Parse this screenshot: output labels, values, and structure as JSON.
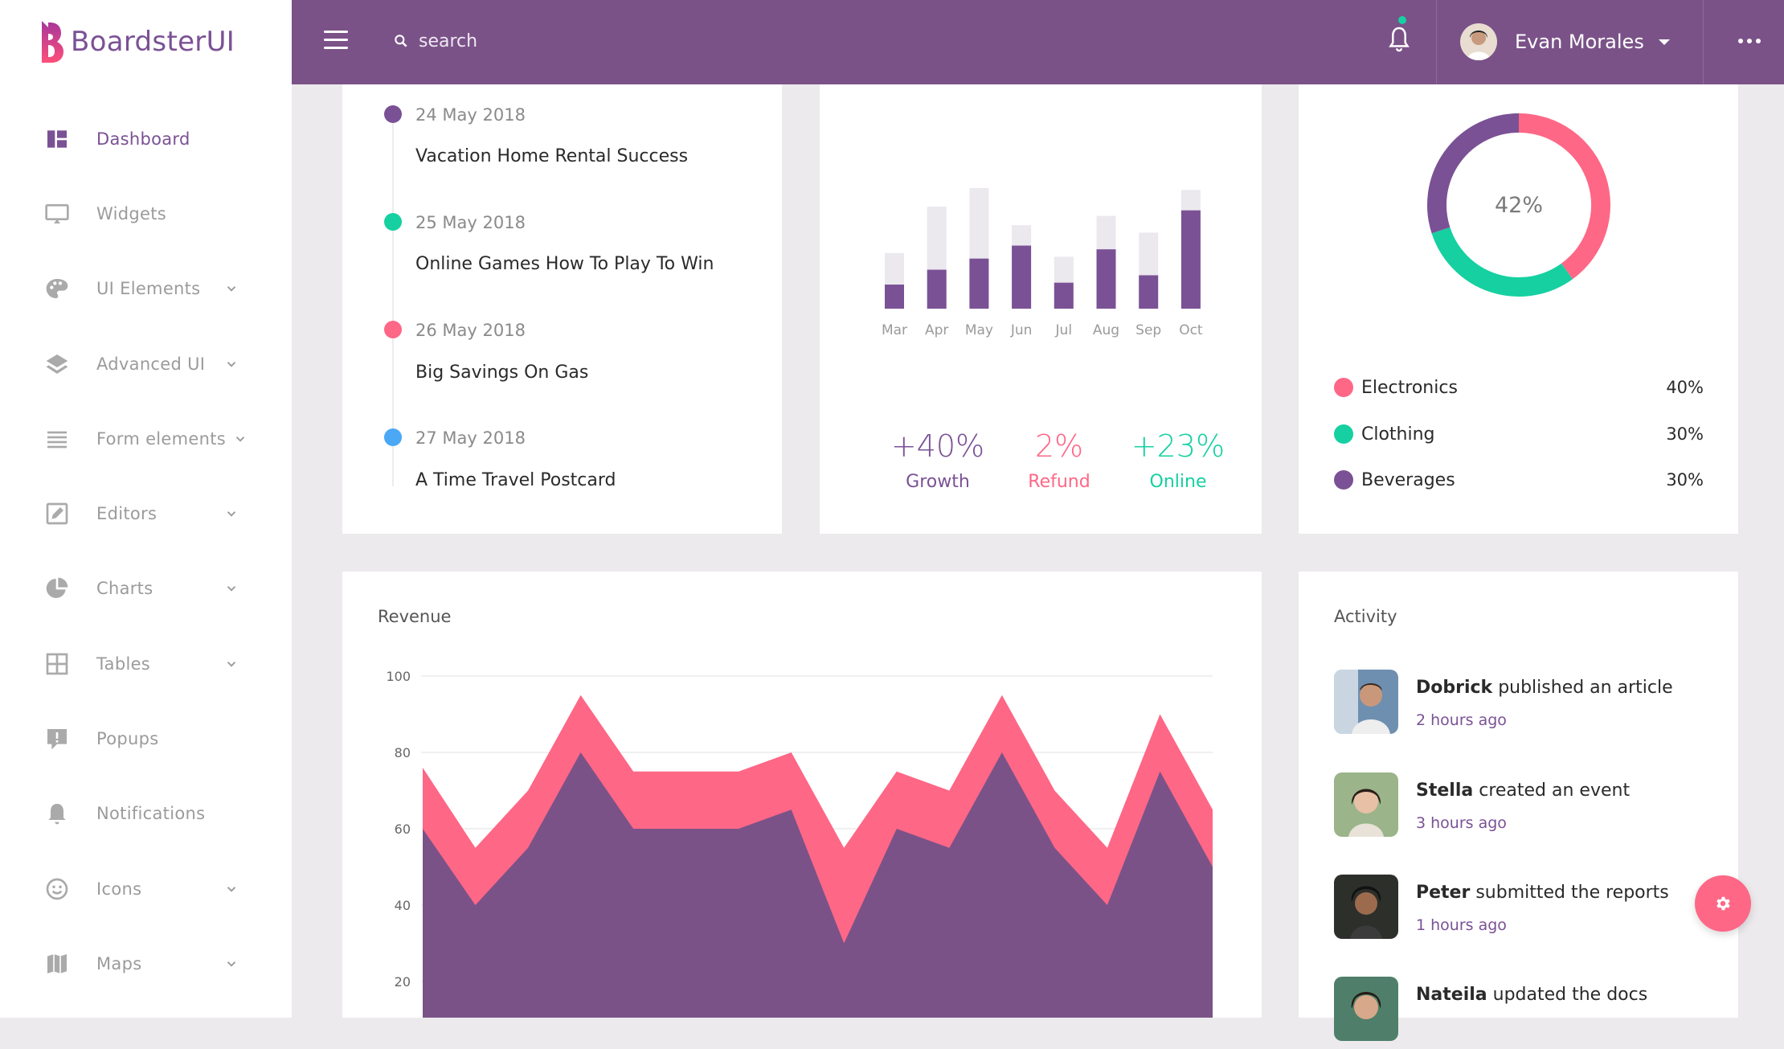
{
  "brand": {
    "name": "BoardsterUI"
  },
  "sidebar": {
    "items": [
      {
        "label": "Dashboard",
        "icon": "dashboard-icon",
        "active": true,
        "chevron": false
      },
      {
        "label": "Widgets",
        "icon": "monitor-icon",
        "chevron": false
      },
      {
        "label": "UI Elements",
        "icon": "palette-icon",
        "chevron": true
      },
      {
        "label": "Advanced UI",
        "icon": "layers-icon",
        "chevron": true
      },
      {
        "label": "Form elements",
        "icon": "list-icon",
        "chevron": true
      },
      {
        "label": "Editors",
        "icon": "edit-icon",
        "chevron": true
      },
      {
        "label": "Charts",
        "icon": "pie-chart-icon",
        "chevron": true
      },
      {
        "label": "Tables",
        "icon": "table-icon",
        "chevron": true
      },
      {
        "label": "Popups",
        "icon": "alert-bubble-icon",
        "chevron": false
      },
      {
        "label": "Notifications",
        "icon": "bell-icon",
        "chevron": false
      },
      {
        "label": "Icons",
        "icon": "smiley-icon",
        "chevron": true
      },
      {
        "label": "Maps",
        "icon": "map-icon",
        "chevron": true
      }
    ]
  },
  "header": {
    "search_placeholder": "search",
    "user_name": "Evan Morales"
  },
  "timeline": [
    {
      "date": "24 May 2018",
      "title": "Vacation Home Rental Success",
      "color": "#7a5195"
    },
    {
      "date": "25 May 2018",
      "title": "Online Games How To Play To Win",
      "color": "#16d0a1"
    },
    {
      "date": "26 May 2018",
      "title": "Big Savings On Gas",
      "color": "#fe6786"
    },
    {
      "date": "27 May 2018",
      "title": "A Time Travel Postcard",
      "color": "#4aa8f5"
    }
  ],
  "stats": [
    {
      "value": "+40%",
      "label": "Growth",
      "color": "#7a5195"
    },
    {
      "value": "2%",
      "label": "Refund",
      "color": "#fe6786"
    },
    {
      "value": "+23%",
      "label": "Online",
      "color": "#16d0a1"
    }
  ],
  "donut": {
    "center_label": "42%",
    "legend": [
      {
        "name": "Electronics",
        "pct": "40%",
        "color": "#fe6786"
      },
      {
        "name": "Clothing",
        "pct": "30%",
        "color": "#16d0a1"
      },
      {
        "name": "Beverages",
        "pct": "30%",
        "color": "#7a5195"
      }
    ]
  },
  "revenue": {
    "title": "Revenue"
  },
  "activity": {
    "title": "Activity",
    "items": [
      {
        "name": "Dobrick",
        "action": "published an article",
        "time": "2 hours ago"
      },
      {
        "name": "Stella",
        "action": "created an event",
        "time": "3 hours ago"
      },
      {
        "name": "Peter",
        "action": "submitted the reports",
        "time": "1 hours ago"
      },
      {
        "name": "Nateila",
        "action": "updated the docs",
        "time": ""
      }
    ]
  },
  "chart_data": [
    {
      "type": "bar",
      "categories": [
        "Mar",
        "Apr",
        "May",
        "Jun",
        "Jul",
        "Aug",
        "Sep",
        "Oct"
      ],
      "series": [
        {
          "values": [
            13,
            21,
            27,
            34,
            14,
            32,
            18,
            53
          ],
          "color": "#7a5195"
        },
        {
          "values": [
            30,
            55,
            65,
            45,
            28,
            50,
            41,
            64
          ],
          "color": "#ebe8ee"
        }
      ],
      "ylim": [
        0,
        65
      ]
    },
    {
      "type": "pie",
      "values": [
        40,
        30,
        30
      ],
      "labels": [
        "Electronics",
        "Clothing",
        "Beverages"
      ],
      "colors": [
        "#fe6786",
        "#16d0a1",
        "#7a5195"
      ]
    },
    {
      "type": "area",
      "title": "Revenue",
      "x": [
        0,
        1,
        2,
        3,
        4,
        5,
        6,
        7,
        8,
        9,
        10,
        11,
        12,
        13,
        14,
        15
      ],
      "series": [
        {
          "values": [
            76,
            55,
            70,
            95,
            75,
            75,
            75,
            80,
            55,
            75,
            70,
            95,
            70,
            55,
            90,
            65
          ],
          "color": "#fe6786"
        },
        {
          "values": [
            60,
            40,
            55,
            80,
            60,
            60,
            60,
            65,
            30,
            60,
            55,
            80,
            55,
            40,
            75,
            50
          ],
          "color": "#7a5288"
        }
      ],
      "yticks": [
        20,
        40,
        60,
        80,
        100
      ],
      "ylim": [
        0,
        100
      ]
    }
  ]
}
